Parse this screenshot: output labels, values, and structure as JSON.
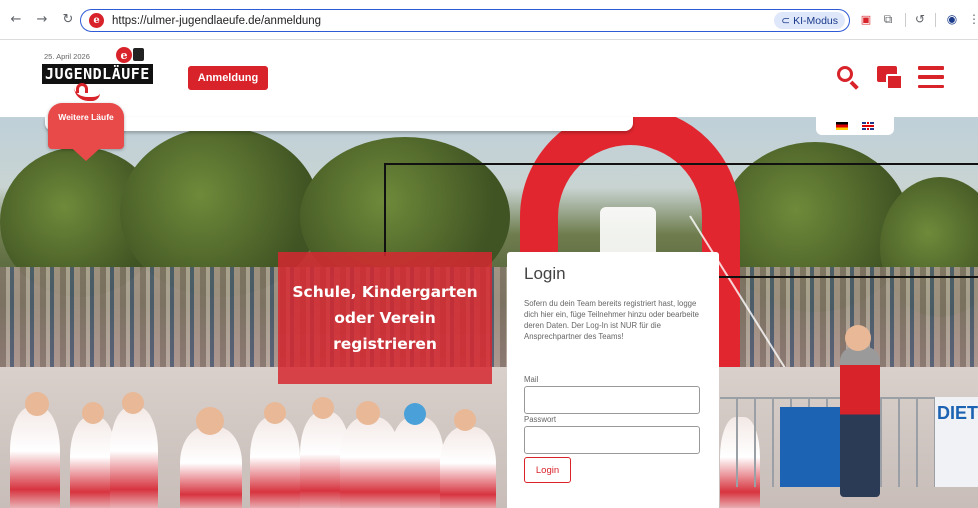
{
  "browser": {
    "url": "https://ulmer-jugendlaeufe.de/anmeldung",
    "ki_mode_label": "KI-Modus",
    "favicon_letter": "e"
  },
  "header": {
    "logo_date": "25. April 2026",
    "logo_text": "JUGENDLÄUFE",
    "logo_badge": "e",
    "anmeldung_label": "Anmeldung"
  },
  "weitere": {
    "label": "Weitere Läufe"
  },
  "registration": {
    "text": "Schule, Kindergarten oder Verein registrieren"
  },
  "login": {
    "title": "Login",
    "description": "Sofern du dein Team bereits registriert hast, logge dich hier ein, füge Teilnehmer hinzu oder bearbeite deren Daten. Der Log-In ist NUR für die Ansprechpartner des Teams!",
    "mail_label": "Mail",
    "mail_value": "",
    "password_label": "Passwort",
    "password_value": "",
    "button_label": "Login"
  },
  "photo": {
    "banner_text": "DIET"
  },
  "colors": {
    "brand_red": "#d8232a",
    "browser_focus": "#2f5bd6"
  }
}
